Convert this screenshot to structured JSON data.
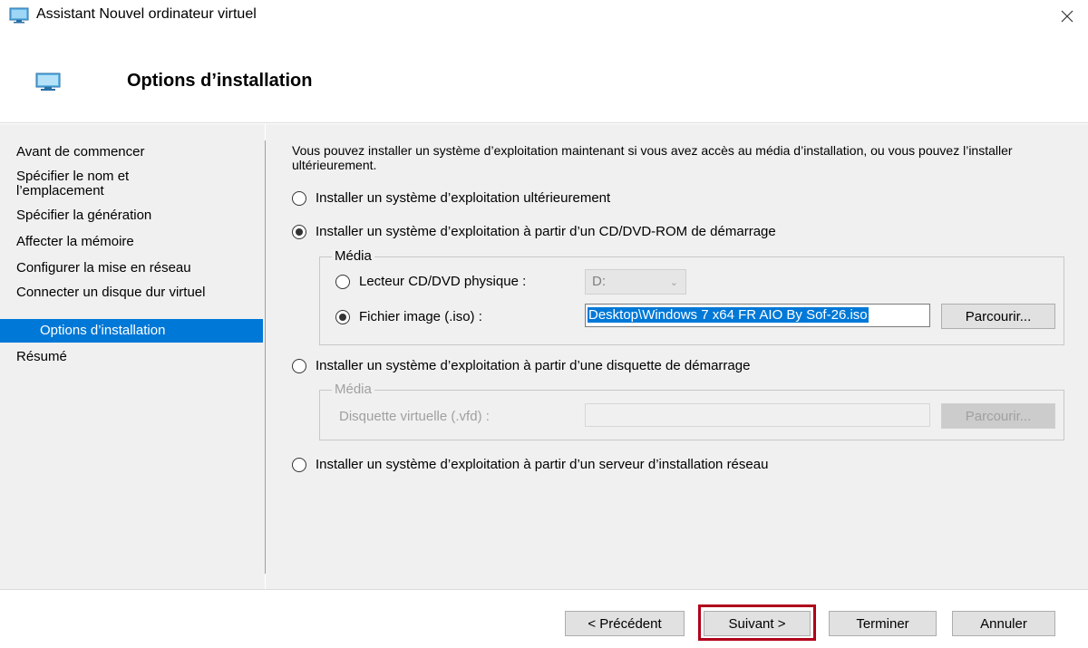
{
  "window": {
    "title": "Assistant Nouvel ordinateur virtuel",
    "close_icon": "close-icon",
    "app_icon": "virtual-machine-icon"
  },
  "header": {
    "title": "Options d’installation"
  },
  "sidebar": {
    "items": [
      {
        "label": "Avant de commencer"
      },
      {
        "label": "Spécifier le nom et l’emplacement"
      },
      {
        "label": "Spécifier la génération"
      },
      {
        "label": "Affecter la mémoire"
      },
      {
        "label": "Configurer la mise en réseau"
      },
      {
        "label": "Connecter un disque dur virtuel"
      },
      {
        "label": "Options d’installation",
        "active": true
      },
      {
        "label": "Résumé"
      }
    ]
  },
  "main": {
    "intro": "Vous pouvez installer un système d’exploitation maintenant si vous avez accès au média d’installation, ou vous pouvez l’installer ultérieurement.",
    "option_later": "Installer un système d’exploitation ultérieurement",
    "option_cd": "Installer un système d’exploitation à partir d’un CD/DVD-ROM de démarrage",
    "cd_group": {
      "legend": "Média",
      "physical_label": "Lecteur CD/DVD physique :",
      "physical_drive": "D:",
      "image_label": "Fichier image (.iso) :",
      "image_path": "Desktop\\Windows 7 x64 FR AIO By Sof-26.iso",
      "browse_label": "Parcourir..."
    },
    "option_floppy": "Installer un système d’exploitation à partir d’une disquette de démarrage",
    "floppy_group": {
      "legend": "Média",
      "vfd_label": "Disquette virtuelle (.vfd) :",
      "vfd_value": "",
      "browse_label": "Parcourir..."
    },
    "option_network": "Installer un système d’exploitation à partir d’un serveur d’installation réseau"
  },
  "footer": {
    "previous": "< Précédent",
    "next": "Suivant >",
    "finish": "Terminer",
    "cancel": "Annuler"
  },
  "colors": {
    "accent": "#0078d7",
    "highlight": "#b0001a",
    "panel": "#f0f0f0"
  }
}
